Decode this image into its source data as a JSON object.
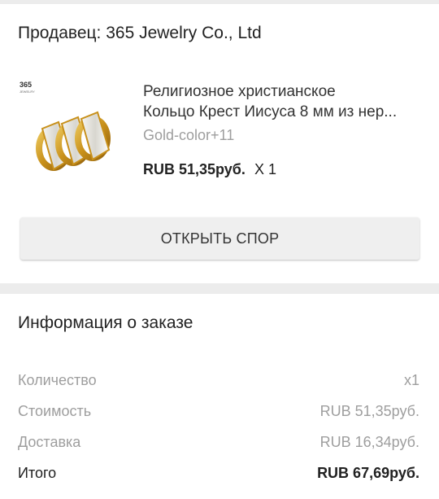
{
  "seller": {
    "label": "Продавец: 365 Jewelry Co., Ltd"
  },
  "product": {
    "thumb_brand": "365",
    "thumb_brand_sub": "JEWELRY",
    "title_line1": "Религиозное христианское",
    "title_line2": "Кольцо Крест Иисуса 8 мм из нер...",
    "variant": "Gold-color+11",
    "price": "RUB 51,35руб.",
    "quantity": "X 1"
  },
  "actions": {
    "open_dispute": "ОТКРЫТЬ СПОР"
  },
  "order_info": {
    "title": "Информация о заказе",
    "rows": [
      {
        "label": "Количество",
        "value": "x1"
      },
      {
        "label": "Стоимость",
        "value": "RUB 51,35руб."
      },
      {
        "label": "Доставка",
        "value": "RUB 16,34руб."
      },
      {
        "label": "Итого",
        "value": "RUB 67,69руб."
      }
    ]
  },
  "colors": {
    "accent_gold": "#d4a21c",
    "muted_text": "#9e9e9e",
    "background": "#ececec"
  }
}
